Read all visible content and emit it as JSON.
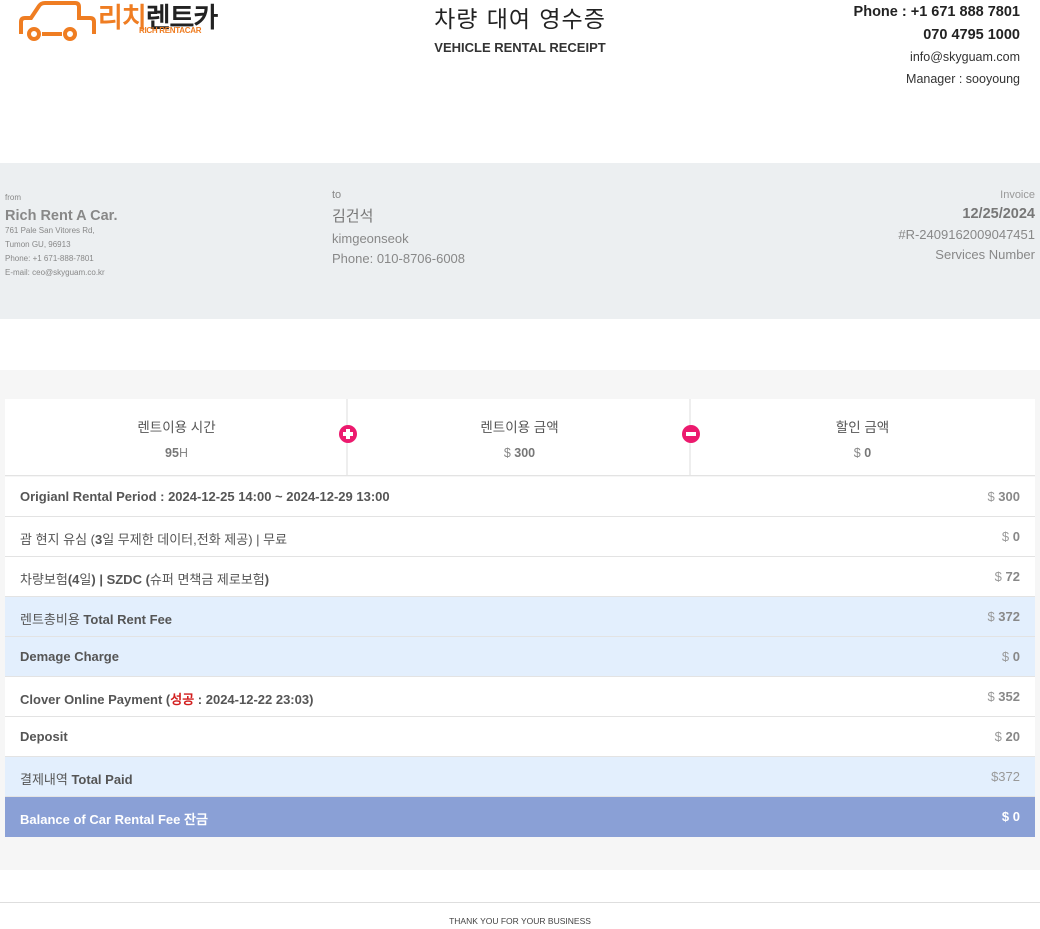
{
  "brand": {
    "logo_ko_part1": "리치",
    "logo_ko_part2": "렌트카",
    "logo_en": "RICH RENTACAR"
  },
  "header": {
    "title_ko": "차량 대여 영수증",
    "title_en": "VEHICLE RENTAL RECEIPT",
    "phone": "Phone : +1 671 888 7801",
    "phone2": "070 4795 1000",
    "email": "info@skyguam.com",
    "manager": "Manager : sooyoung"
  },
  "from": {
    "label": "from",
    "name": "Rich Rent A Car.",
    "address1": "761 Pale San Vitores Rd,",
    "address2": "Tumon GU, 96913",
    "phone": "Phone: +1 671-888-7801",
    "email": "E-mail: ceo@skyguam.co.kr"
  },
  "to": {
    "label": "to",
    "name": "김건석",
    "username": "kimgeonseok",
    "phone": "Phone: 010-8706-6008"
  },
  "invoice": {
    "label": "Invoice",
    "date": "12/25/2024",
    "number": "#R-2409162009047451",
    "services_label": "Services Number"
  },
  "summary": {
    "rental_time_label": "렌트이용 시간",
    "rental_time_value": "95",
    "rental_time_unit": "H",
    "rental_amount_label": "렌트이용 금액",
    "rental_amount_currency": "$",
    "rental_amount_value": "300",
    "discount_label": "할인 금액",
    "discount_currency": "$",
    "discount_value": "0",
    "icon_plus": "plus-circle-icon",
    "icon_minus": "minus-circle-icon",
    "icon_color": "#ec1a6e"
  },
  "line_items": {
    "r1_label": "Origianl Rental Period : 2024-12-25 14:00 ~ 2024-12-29 13:00",
    "r1_cur": "$",
    "r1_val": "300",
    "r2_label_a": "괌 현지 유심 (",
    "r2_label_b": "3",
    "r2_label_c": "일 무제한 데이터,전화 제공) | 무료",
    "r2_cur": "$",
    "r2_val": "0",
    "r3_label_a": "차량보험",
    "r3_label_b": "(4",
    "r3_label_c": "일",
    "r3_label_d": ") | SZDC (",
    "r3_label_e": "슈퍼 면책금 제로보험",
    "r3_label_f": ")",
    "r3_cur": "$",
    "r3_val": "72",
    "r4_label_a": "렌트총비용",
    "r4_label_b": " Total Rent Fee",
    "r4_cur": "$",
    "r4_val": "372",
    "r5_label": "Demage Charge",
    "r5_cur": "$",
    "r5_val": "0",
    "r6_label_a": "Clover Online Payment (",
    "r6_label_b": "성공",
    "r6_label_c": " : 2024-12-22 23:03)",
    "r6_cur": "$",
    "r6_val": "352",
    "r7_label": "Deposit",
    "r7_cur": "$",
    "r7_val": "20",
    "r8_label_a": "결제내역",
    "r8_label_b": " Total Paid",
    "r8_val": "$372",
    "r9_label_a": "Balance of Car Rental Fee ",
    "r9_label_b": "잔금",
    "r9_cur": "$",
    "r9_val": "0"
  },
  "colors": {
    "brand_orange": "#ef7d22",
    "info_band": "#eceff1",
    "highlight_row": "#e3effd",
    "balance_row": "#8aa0d6",
    "success_red": "#d21d1d"
  },
  "footer": {
    "text": "THANK YOU FOR YOUR BUSINESS"
  }
}
